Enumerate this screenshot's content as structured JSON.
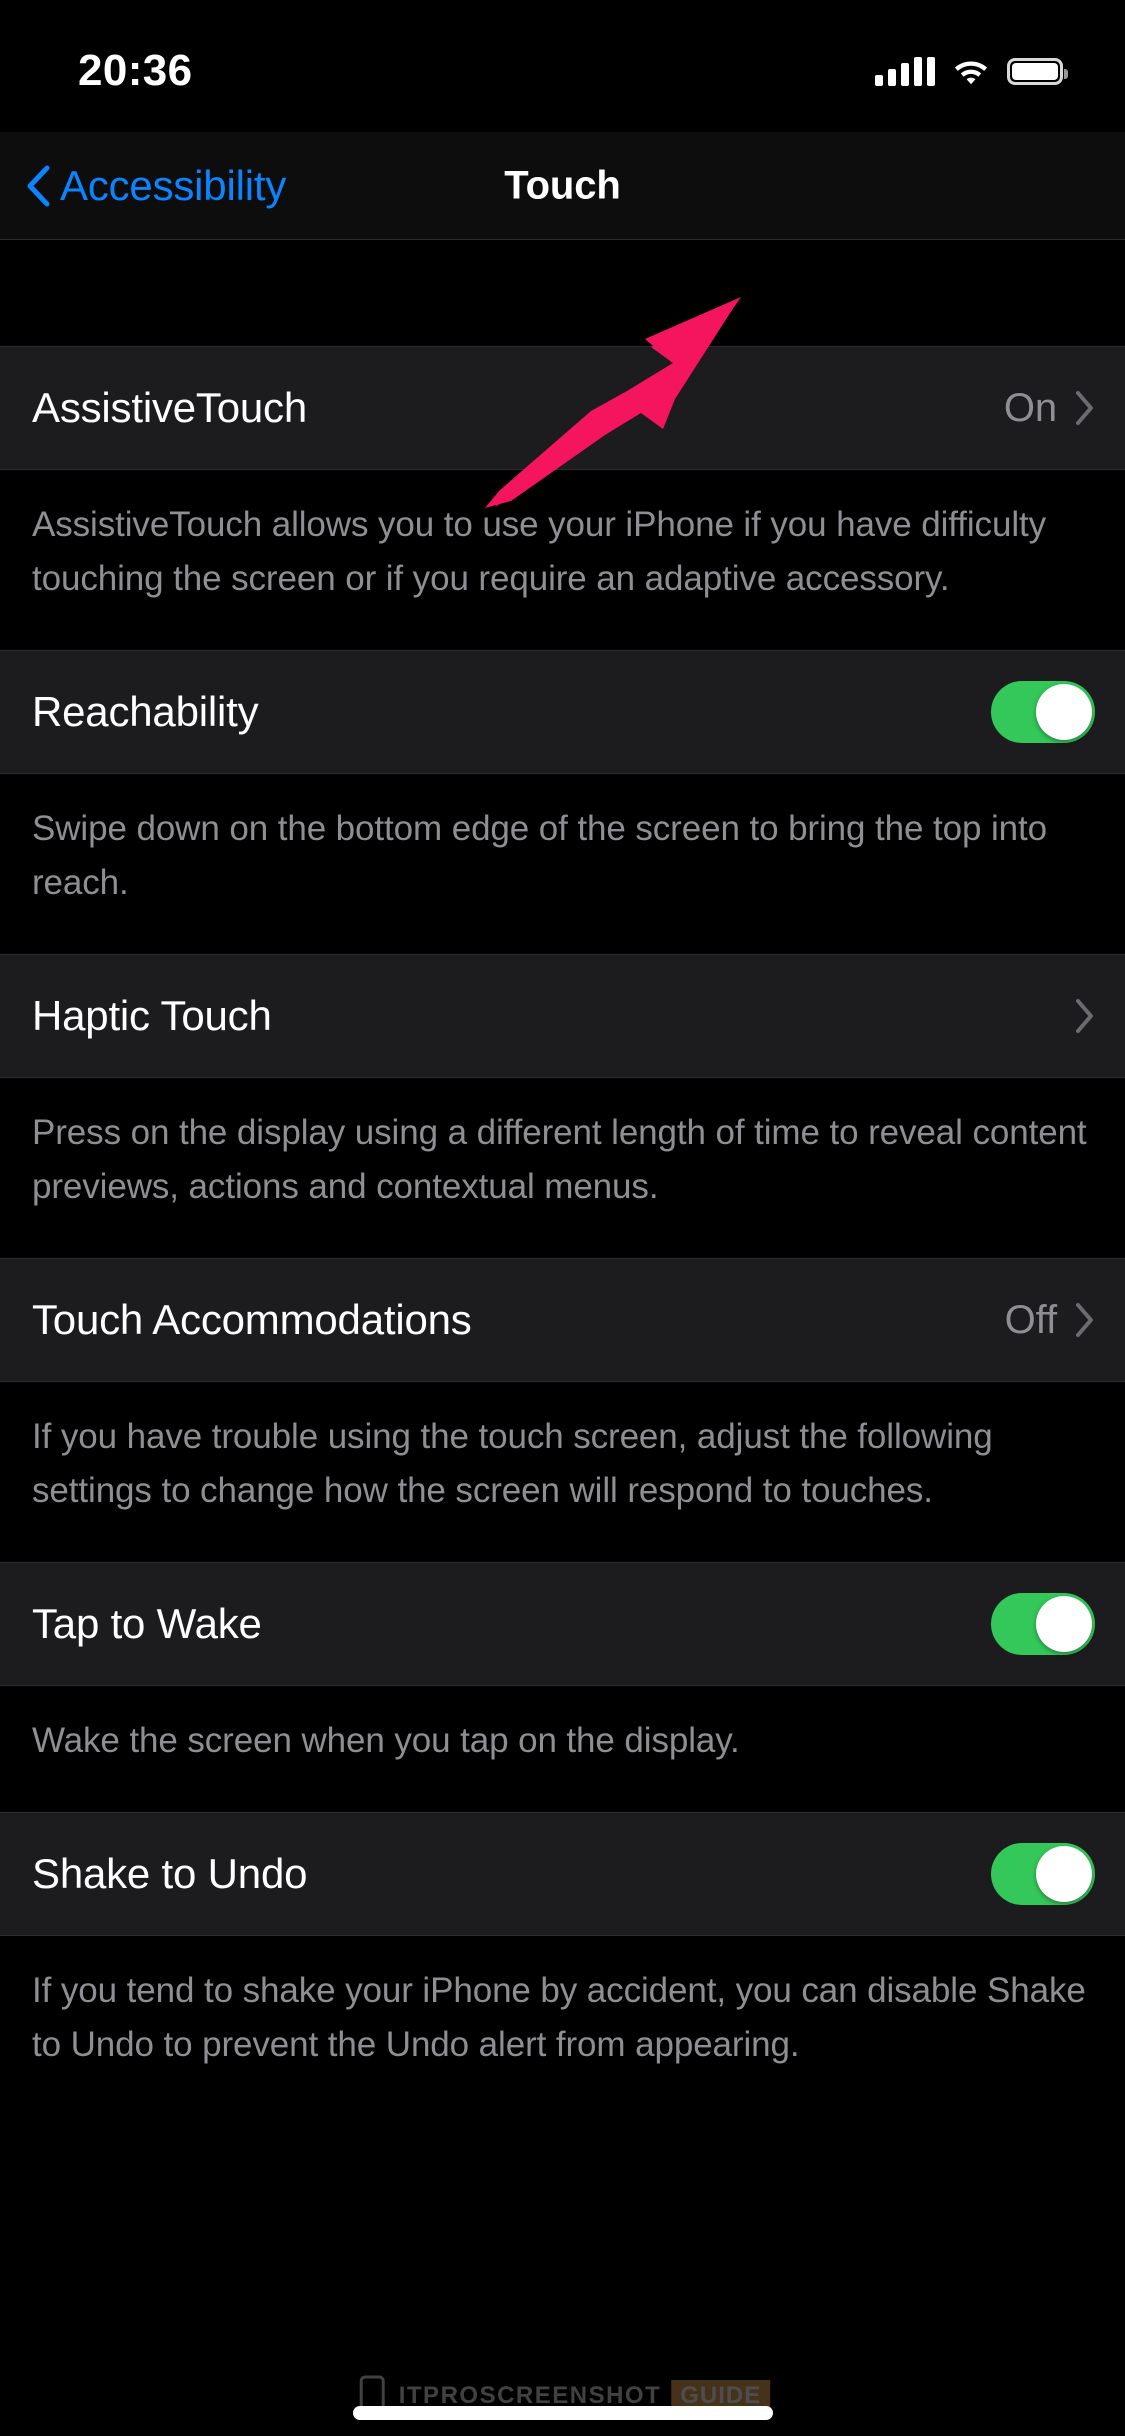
{
  "status_bar": {
    "time": "20:36",
    "cellular_icon": "cellular-signal-icon",
    "wifi_icon": "wifi-icon",
    "battery_icon": "battery-full-icon"
  },
  "nav": {
    "back_label": "Accessibility",
    "back_icon": "chevron-left-icon",
    "title": "Touch"
  },
  "colors": {
    "accent_blue": "#0a84ff",
    "toggle_on_green": "#34c759",
    "annotation_pink": "#f5155f",
    "cell_background": "#1c1c1e",
    "secondary_text": "#8e8e93"
  },
  "sections": [
    {
      "row": {
        "title": "AssistiveTouch",
        "value": "On",
        "type": "disclosure",
        "accessory_icon": "chevron-right-icon"
      },
      "footer": "AssistiveTouch allows you to use your iPhone if you have difficulty touching the screen or if you require an adaptive accessory."
    },
    {
      "row": {
        "title": "Reachability",
        "type": "toggle",
        "toggle_state": "on"
      },
      "footer": "Swipe down on the bottom edge of the screen to bring the top into reach."
    },
    {
      "row": {
        "title": "Haptic Touch",
        "value": "",
        "type": "disclosure",
        "accessory_icon": "chevron-right-icon"
      },
      "footer": "Press on the display using a different length of time to reveal content previews, actions and contextual menus."
    },
    {
      "row": {
        "title": "Touch Accommodations",
        "value": "Off",
        "type": "disclosure",
        "accessory_icon": "chevron-right-icon"
      },
      "footer": "If you have trouble using the touch screen, adjust the following settings to change how the screen will respond to touches."
    },
    {
      "row": {
        "title": "Tap to Wake",
        "type": "toggle",
        "toggle_state": "on"
      },
      "footer": "Wake the screen when you tap on the display."
    },
    {
      "row": {
        "title": "Shake to Undo",
        "type": "toggle",
        "toggle_state": "on"
      },
      "footer": "If you tend to shake your iPhone by accident, you can disable Shake to Undo to prevent the Undo alert from appearing."
    }
  ],
  "annotation": {
    "type": "arrow",
    "points_to": "AssistiveTouch row disclosure chevron"
  },
  "watermark": {
    "text": "ITPROSCREENSHOT",
    "badge": "GUIDE"
  }
}
